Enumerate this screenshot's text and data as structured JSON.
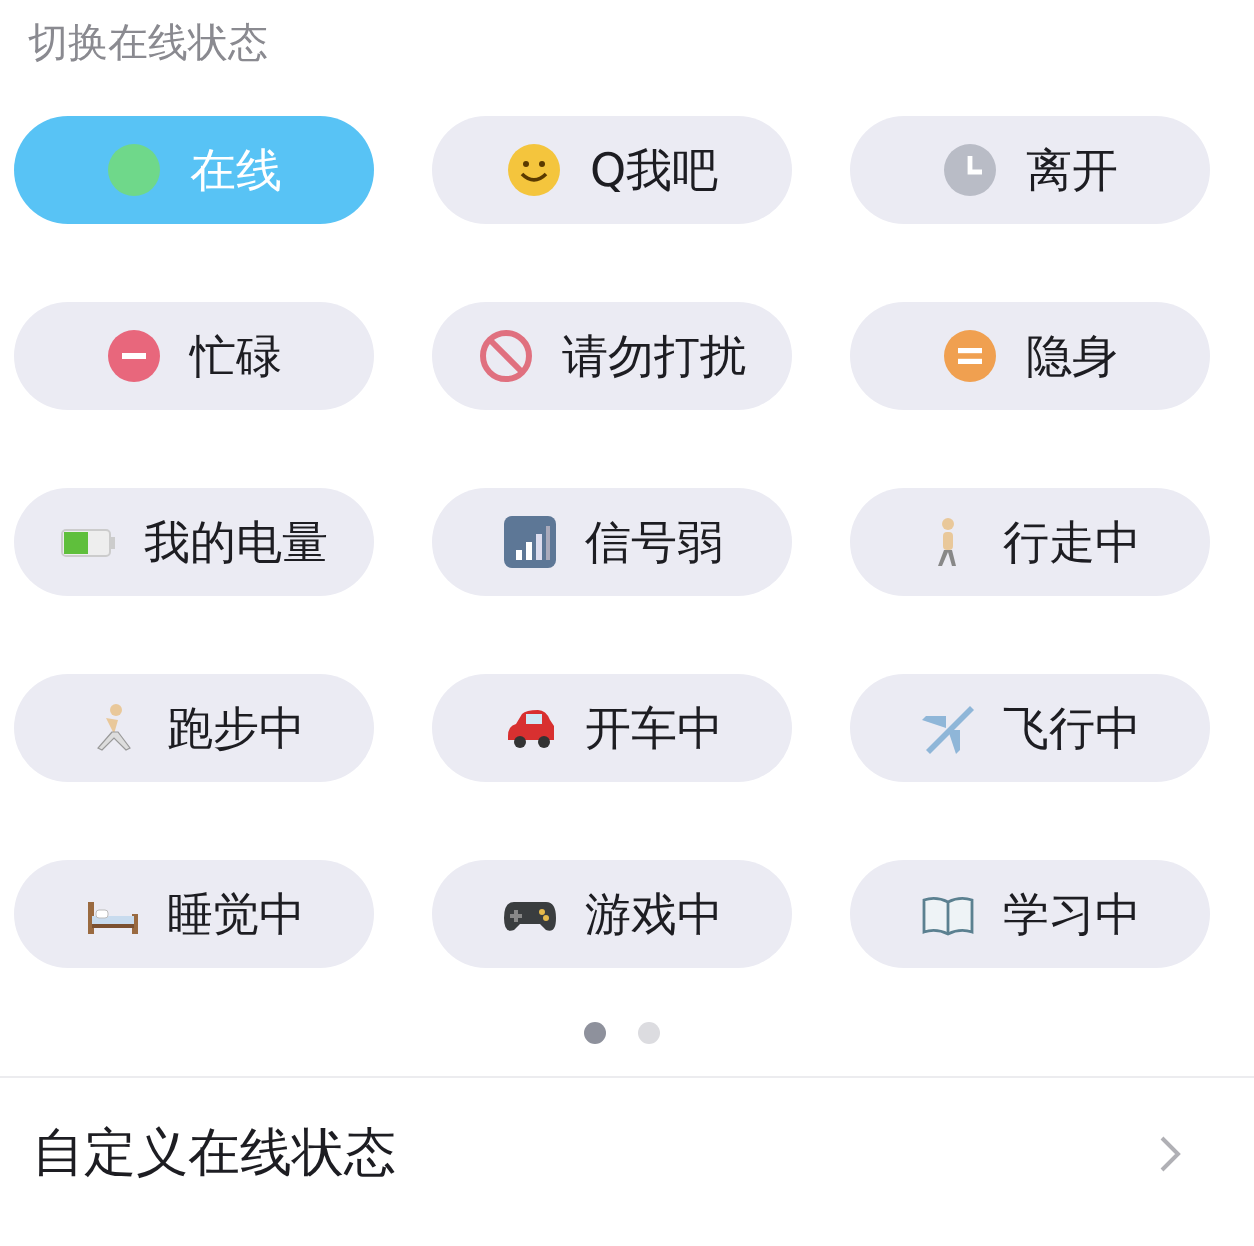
{
  "title": "切换在线状态",
  "statuses": [
    {
      "label": "在线",
      "kind": "dot",
      "selected": true
    },
    {
      "label": "Q我吧",
      "kind": "smiley",
      "selected": false
    },
    {
      "label": "离开",
      "kind": "clock",
      "selected": false
    },
    {
      "label": "忙碌",
      "kind": "minus",
      "selected": false
    },
    {
      "label": "请勿打扰",
      "kind": "forbidden",
      "selected": false
    },
    {
      "label": "隐身",
      "kind": "equals",
      "selected": false
    },
    {
      "label": "我的电量",
      "kind": "battery",
      "selected": false
    },
    {
      "label": "信号弱",
      "kind": "signal",
      "selected": false
    },
    {
      "label": "行走中",
      "kind": "walker",
      "selected": false
    },
    {
      "label": "跑步中",
      "kind": "runner",
      "selected": false
    },
    {
      "label": "开车中",
      "kind": "car",
      "selected": false
    },
    {
      "label": "飞行中",
      "kind": "plane",
      "selected": false
    },
    {
      "label": "睡觉中",
      "kind": "bed",
      "selected": false
    },
    {
      "label": "游戏中",
      "kind": "gamepad",
      "selected": false
    },
    {
      "label": "学习中",
      "kind": "book",
      "selected": false
    }
  ],
  "pages": [
    {
      "selected": true
    },
    {
      "selected": false
    }
  ],
  "custom": {
    "label": "自定义在线状态"
  }
}
